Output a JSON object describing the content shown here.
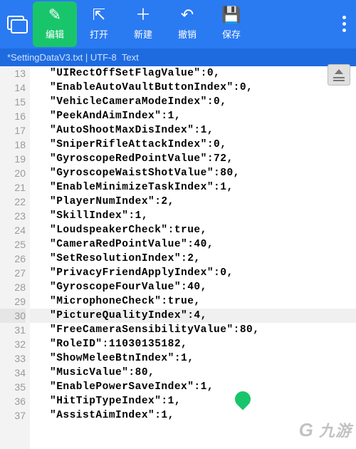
{
  "toolbar": {
    "edit": "编辑",
    "open": "打开",
    "new": "新建",
    "undo": "撤销",
    "save": "保存"
  },
  "status": {
    "filename": "*SettingDataV3.txt",
    "sep": " | ",
    "encoding": "UTF-8",
    "mode": "Text"
  },
  "watermark": "九游",
  "lines": [
    {
      "n": 13,
      "t": "\"UIRectOffSetFlagValue\":0,"
    },
    {
      "n": 14,
      "t": "\"EnableAutoVaultButtonIndex\":0,"
    },
    {
      "n": 15,
      "t": "\"VehicleCameraModeIndex\":0,"
    },
    {
      "n": 16,
      "t": "\"PeekAndAimIndex\":1,"
    },
    {
      "n": 17,
      "t": "\"AutoShootMaxDisIndex\":1,"
    },
    {
      "n": 18,
      "t": "\"SniperRifleAttackIndex\":0,"
    },
    {
      "n": 19,
      "t": "\"GyroscopeRedPointValue\":72,"
    },
    {
      "n": 20,
      "t": "\"GyroscopeWaistShotValue\":80,"
    },
    {
      "n": 21,
      "t": "\"EnableMinimizeTaskIndex\":1,"
    },
    {
      "n": 22,
      "t": "\"PlayerNumIndex\":2,"
    },
    {
      "n": 23,
      "t": "\"SkillIndex\":1,"
    },
    {
      "n": 24,
      "t": "\"LoudspeakerCheck\":true,"
    },
    {
      "n": 25,
      "t": "\"CameraRedPointValue\":40,"
    },
    {
      "n": 26,
      "t": "\"SetResolutionIndex\":2,"
    },
    {
      "n": 27,
      "t": "\"PrivacyFriendApplyIndex\":0,"
    },
    {
      "n": 28,
      "t": "\"GyroscopeFourValue\":40,"
    },
    {
      "n": 29,
      "t": "\"MicrophoneCheck\":true,"
    },
    {
      "n": 30,
      "t": "\"PictureQualityIndex\":4,",
      "hl": true
    },
    {
      "n": 31,
      "t": "\"FreeCameraSensibilityValue\":80,"
    },
    {
      "n": 32,
      "t": "\"RoleID\":11030135182,"
    },
    {
      "n": 33,
      "t": "\"ShowMeleeBtnIndex\":1,"
    },
    {
      "n": 34,
      "t": "\"MusicValue\":80,"
    },
    {
      "n": 35,
      "t": "\"EnablePowerSaveIndex\":1,"
    },
    {
      "n": 36,
      "t": "\"HitTipTypeIndex\":1,"
    },
    {
      "n": 37,
      "t": "\"AssistAimIndex\":1,"
    }
  ]
}
